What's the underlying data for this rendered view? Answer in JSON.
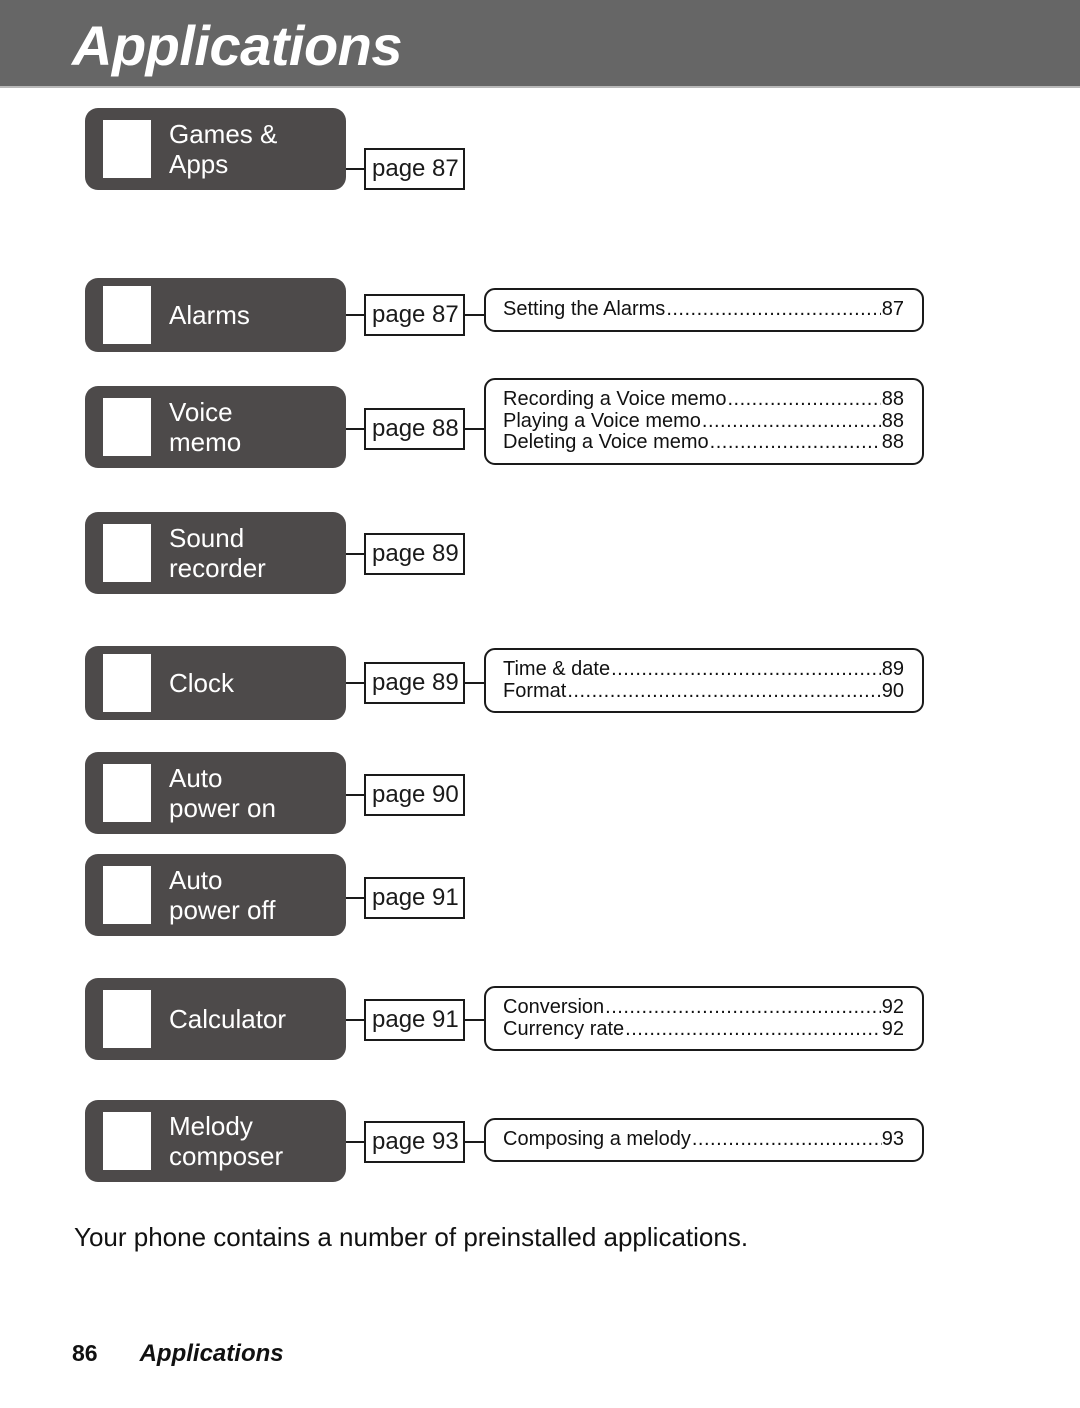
{
  "header": {
    "title": "Applications",
    "band_color": "#666666"
  },
  "rows": [
    {
      "id": "games-apps",
      "label": "Games &\nApps",
      "icon": "app-icon-placeholder",
      "page_label": "page 87",
      "details": []
    },
    {
      "id": "alarms",
      "label": "Alarms",
      "icon": "app-icon-placeholder",
      "page_label": "page 87",
      "details": [
        {
          "text": "Setting the Alarms",
          "page": "87"
        }
      ]
    },
    {
      "id": "voice-memo",
      "label": "Voice\nmemo",
      "icon": "app-icon-placeholder",
      "page_label": "page 88",
      "details": [
        {
          "text": "Recording a Voice memo",
          "page": "88"
        },
        {
          "text": "Playing a Voice memo",
          "page": "88"
        },
        {
          "text": "Deleting a Voice memo",
          "page": "88"
        }
      ]
    },
    {
      "id": "sound-recorder",
      "label": "Sound\nrecorder",
      "icon": "app-icon-placeholder",
      "page_label": "page 89",
      "details": []
    },
    {
      "id": "clock",
      "label": "Clock",
      "icon": "app-icon-placeholder",
      "page_label": "page 89",
      "details": [
        {
          "text": "Time & date",
          "page": "89"
        },
        {
          "text": "Format",
          "page": "90"
        }
      ]
    },
    {
      "id": "auto-power-on",
      "label": "Auto\npower on",
      "icon": "app-icon-placeholder",
      "page_label": "page 90",
      "details": []
    },
    {
      "id": "auto-power-off",
      "label": "Auto\npower off",
      "icon": "app-icon-placeholder",
      "page_label": "page 91",
      "details": []
    },
    {
      "id": "calculator",
      "label": "Calculator",
      "icon": "app-icon-placeholder",
      "page_label": "page 91",
      "details": [
        {
          "text": "Conversion",
          "page": "92"
        },
        {
          "text": "Currency rate",
          "page": "92"
        }
      ]
    },
    {
      "id": "melody-composer",
      "label": "Melody\ncomposer",
      "icon": "app-icon-placeholder",
      "page_label": "page 93",
      "details": [
        {
          "text": "Composing a melody",
          "page": "93"
        }
      ]
    }
  ],
  "bottom_note": "Your phone contains a number of preinstalled applications.",
  "footer": {
    "page_number": "86",
    "section": "Applications"
  }
}
